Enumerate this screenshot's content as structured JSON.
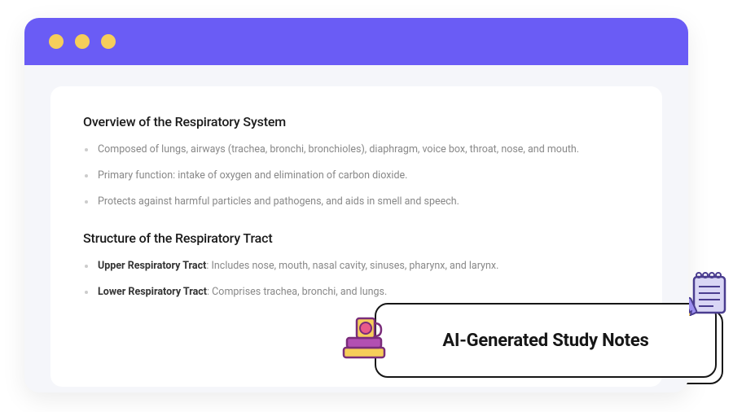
{
  "sections": [
    {
      "heading": "Overview of the Respiratory System",
      "items": [
        {
          "text": "Composed of lungs, airways (trachea, bronchi, bronchioles), diaphragm, voice box, throat, nose, and mouth."
        },
        {
          "text": "Primary function: intake of oxygen and elimination of carbon dioxide."
        },
        {
          "text": "Protects against harmful particles and pathogens, and aids in smell and speech."
        }
      ]
    },
    {
      "heading": "Structure of the Respiratory Tract",
      "items": [
        {
          "bold": "Upper Respiratory Tract",
          "text": ": Includes nose, mouth, nasal cavity, sinuses, pharynx, and larynx."
        },
        {
          "bold": "Lower Respiratory Tract",
          "text": ": Comprises trachea, bronchi, and lungs."
        }
      ]
    }
  ],
  "overlay": {
    "title": "AI-Generated Study Notes"
  }
}
